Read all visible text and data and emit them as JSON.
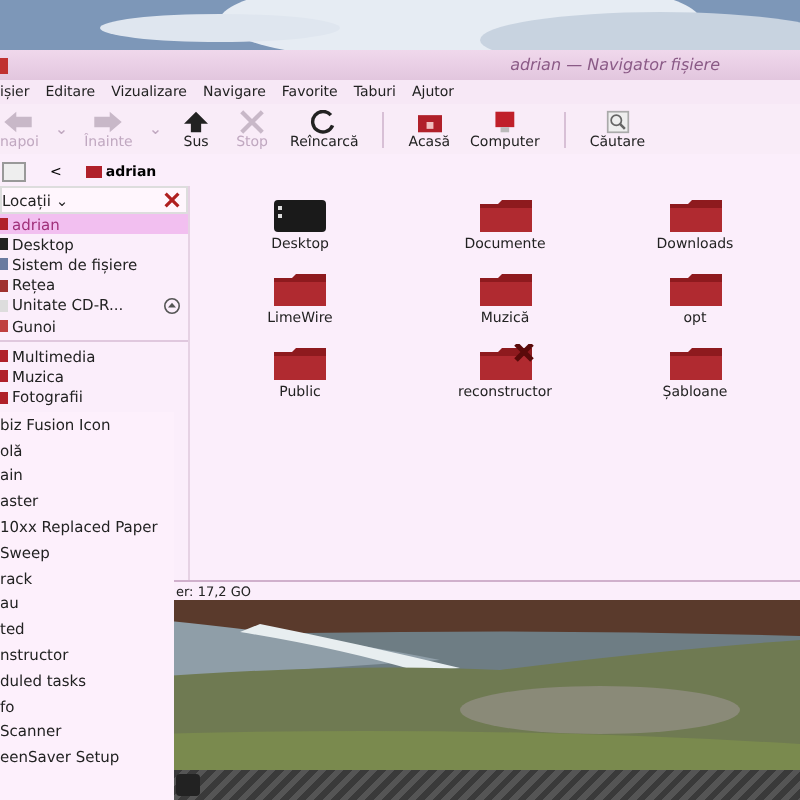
{
  "window": {
    "title": "adrian — Navigator fișiere"
  },
  "menu_bar": [
    "ișier",
    "Editare",
    "Vizualizare",
    "Navigare",
    "Favorite",
    "Taburi",
    "Ajutor"
  ],
  "toolbar": [
    {
      "kind": "back",
      "label": "napoi",
      "disabled": true
    },
    {
      "kind": "dropdown",
      "label": "⌄",
      "disabled": true
    },
    {
      "kind": "forward",
      "label": "Înainte",
      "disabled": true
    },
    {
      "kind": "dropdown",
      "label": "⌄",
      "disabled": true
    },
    {
      "kind": "up",
      "label": "Sus",
      "disabled": false
    },
    {
      "kind": "stop",
      "label": "Stop",
      "disabled": true
    },
    {
      "kind": "reload",
      "label": "Reîncarcă",
      "disabled": false
    },
    {
      "kind": "separator"
    },
    {
      "kind": "home",
      "label": "Acasă",
      "disabled": false
    },
    {
      "kind": "computer",
      "label": "Computer",
      "disabled": false
    },
    {
      "kind": "separator"
    },
    {
      "kind": "search",
      "label": "Căutare",
      "disabled": false
    }
  ],
  "location_bar": {
    "back": "<",
    "path": "adrian"
  },
  "sidebar": {
    "header": "Locații",
    "header_caret": "⌄",
    "items": [
      {
        "label": "adrian",
        "kind": "home",
        "selected": true,
        "ejectable": false
      },
      {
        "label": "Desktop",
        "kind": "desktop",
        "selected": false,
        "ejectable": false
      },
      {
        "label": "Sistem de fișiere",
        "kind": "filesystem",
        "selected": false,
        "ejectable": false
      },
      {
        "label": "Rețea",
        "kind": "network",
        "selected": false,
        "ejectable": false
      },
      {
        "label": "Unitate CD-R...",
        "kind": "cdrom",
        "selected": false,
        "ejectable": true
      },
      {
        "label": "Gunoi",
        "kind": "trash",
        "selected": false,
        "ejectable": false
      }
    ],
    "bookmarks": [
      "Multimedia",
      "Muzica",
      "Fotografii"
    ]
  },
  "files": [
    {
      "name": "Desktop",
      "kind": "desktop"
    },
    {
      "name": "Documente",
      "kind": "folder"
    },
    {
      "name": "Downloads",
      "kind": "folder"
    },
    {
      "name": "LimeWire",
      "kind": "folder"
    },
    {
      "name": "Muzică",
      "kind": "folder"
    },
    {
      "name": "opt",
      "kind": "folder"
    },
    {
      "name": "Public",
      "kind": "folder"
    },
    {
      "name": "reconstructor",
      "kind": "broken"
    },
    {
      "name": "Șabloane",
      "kind": "folder"
    }
  ],
  "status_bar": "er: 17,2 GO",
  "app_menu": {
    "items": [
      "biz Fusion Icon",
      "olă",
      "ain",
      "aster",
      "10xx Replaced Paper",
      "Sweep",
      "rack",
      "au",
      "ted",
      "nstructor",
      "duled tasks",
      "fo",
      "Scanner",
      "eenSaver Setup"
    ]
  }
}
